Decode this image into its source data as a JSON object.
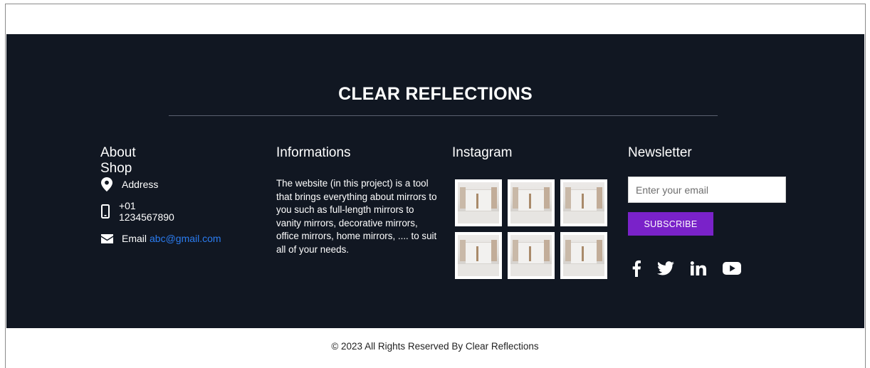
{
  "brand": {
    "name": "CLEAR REFLECTIONS"
  },
  "about": {
    "title": "About Shop",
    "address": "Address",
    "phone": "+01 1234567890",
    "email_label": "Email",
    "email_value": "abc@gmail.com",
    "icons": [
      "map-pin-icon",
      "phone-icon",
      "envelope-icon"
    ]
  },
  "info": {
    "title": "Informations",
    "text": "The website (in this project) is a tool that brings everything about mirrors to you such as full-length mirrors to vanity mirrors, decorative mirrors, office mirrors, home mirrors, .... to suit all of your needs."
  },
  "instagram": {
    "title": "Instagram",
    "thumb_count": 6
  },
  "newsletter": {
    "title": "Newsletter",
    "email_placeholder": "Enter your email",
    "subscribe_label": "SUBSCRIBE",
    "social": [
      "facebook-icon",
      "twitter-icon",
      "linkedin-icon",
      "youtube-icon"
    ]
  },
  "colors": {
    "footer_bg": "#111722",
    "accent": "#7a22c9",
    "link": "#2b7cf0"
  },
  "copyright": "© 2023 All Rights Reserved By Clear Reflections"
}
